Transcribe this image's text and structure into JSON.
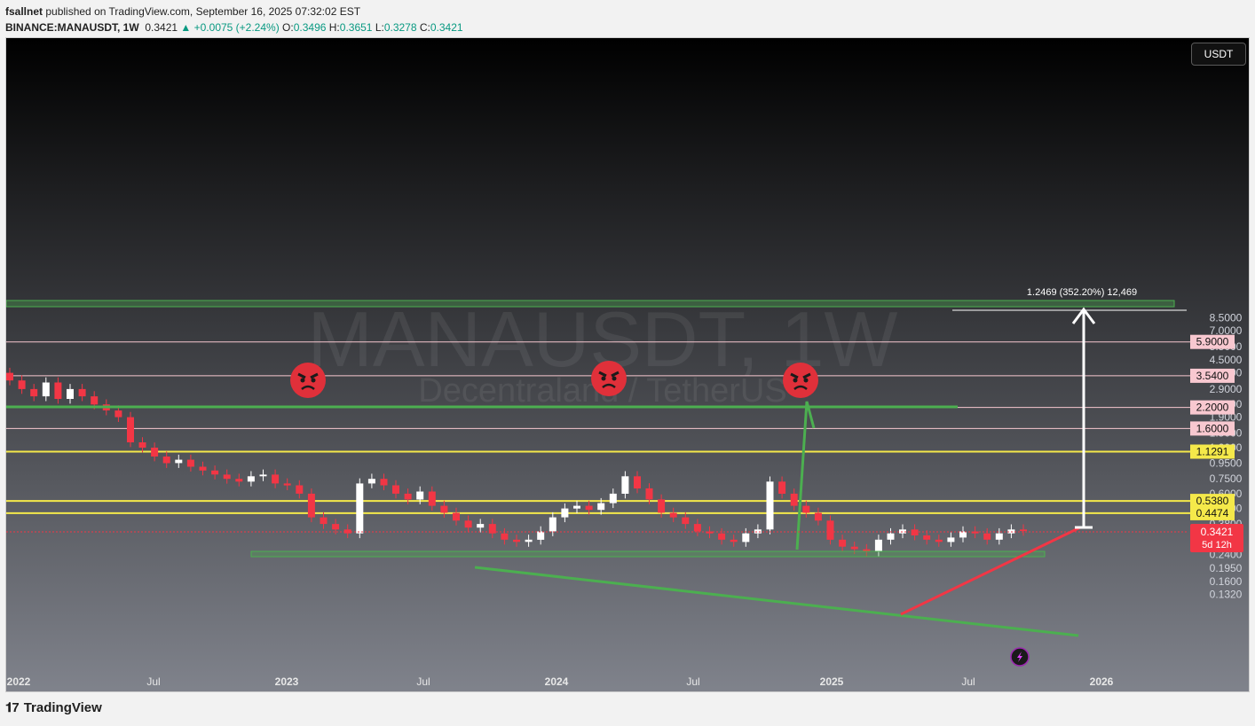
{
  "header": {
    "publisher": "fsallnet",
    "published_text": "published on TradingView.com, September 16, 2025 07:32:02 EST",
    "symbol": "BINANCE:MANAUSDT, 1W",
    "last": "0.3421",
    "change": "+0.0075 (+2.24%)",
    "o_label": "O:",
    "o": "0.3496",
    "h_label": "H:",
    "h": "0.3651",
    "l_label": "L:",
    "l": "0.3278",
    "c_label": "C:",
    "c": "0.3421"
  },
  "currency_button": "USDT",
  "watermark": {
    "symbol": "MANAUSDT, 1W",
    "name": "Decentraland / TetherUS"
  },
  "price_axis": [
    "8.5000",
    "7.0000",
    "5.5000",
    "4.5000",
    "3.7000",
    "2.9000",
    "2.3000",
    "1.9000",
    "1.5000",
    "1.2000",
    "0.9500",
    "0.7500",
    "0.6000",
    "0.4800",
    "0.3800",
    "0.3000",
    "0.2400",
    "0.1950",
    "0.1600",
    "0.1320"
  ],
  "time_axis": [
    "2022",
    "Jul",
    "2023",
    "Jul",
    "2024",
    "Jul",
    "2025",
    "Jul",
    "2026"
  ],
  "levels": [
    {
      "price": "5.9000",
      "color": "#f8c8d0"
    },
    {
      "price": "3.5400",
      "color": "#f8c8d0"
    },
    {
      "price": "2.2000",
      "color": "#f8c8d0"
    },
    {
      "price": "1.6000",
      "color": "#f8c8d0"
    },
    {
      "price": "1.1291",
      "color": "#f5e94a"
    },
    {
      "price": "0.5380",
      "color": "#f5e94a"
    },
    {
      "price": "0.4474",
      "color": "#f5e94a"
    }
  ],
  "current_price": {
    "value": "0.3421",
    "countdown": "5d 12h",
    "color": "#f23645"
  },
  "measure_label": "1.2469 (352.20%) 12,469",
  "colors": {
    "up": "#ffffff",
    "down": "#f23645",
    "green_line": "#4caf50",
    "red_line": "#f23645",
    "yellow": "#f5e94a"
  },
  "chart_data": {
    "type": "candlestick",
    "scale": "log",
    "ylim": [
      0.13,
      9.0
    ],
    "x_range": [
      "2022-01",
      "2026-02"
    ],
    "weekly_close_approx": [
      3.3,
      2.9,
      2.6,
      3.2,
      2.5,
      2.9,
      2.6,
      2.3,
      2.1,
      1.9,
      1.3,
      1.2,
      1.05,
      0.95,
      1.0,
      0.9,
      0.85,
      0.8,
      0.75,
      0.72,
      0.78,
      0.8,
      0.7,
      0.68,
      0.6,
      0.42,
      0.38,
      0.35,
      0.33,
      0.7,
      0.75,
      0.68,
      0.6,
      0.55,
      0.62,
      0.5,
      0.45,
      0.4,
      0.36,
      0.38,
      0.33,
      0.3,
      0.29,
      0.3,
      0.34,
      0.42,
      0.48,
      0.5,
      0.47,
      0.52,
      0.6,
      0.78,
      0.65,
      0.55,
      0.45,
      0.42,
      0.38,
      0.34,
      0.33,
      0.3,
      0.29,
      0.33,
      0.35,
      0.72,
      0.6,
      0.5,
      0.45,
      0.4,
      0.3,
      0.27,
      0.26,
      0.25,
      0.3,
      0.33,
      0.35,
      0.32,
      0.3,
      0.29,
      0.31,
      0.34,
      0.33,
      0.3,
      0.33,
      0.35,
      0.3421
    ]
  }
}
